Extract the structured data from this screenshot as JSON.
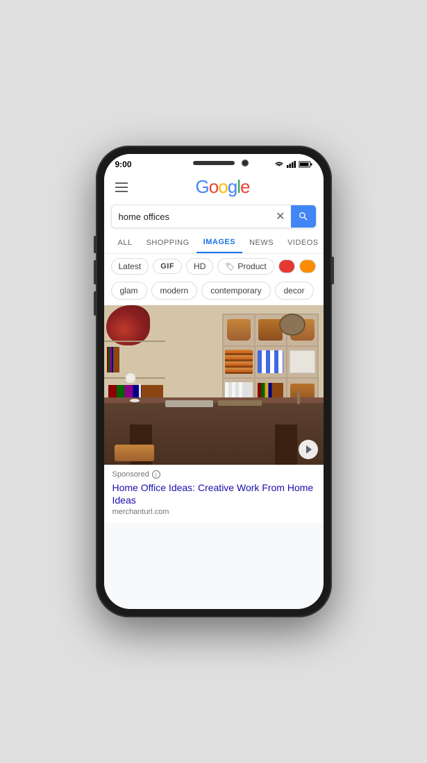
{
  "phone": {
    "status_time": "9:00"
  },
  "search": {
    "query": "home offices",
    "placeholder": "Search"
  },
  "tabs": [
    {
      "label": "ALL",
      "active": false
    },
    {
      "label": "SHOPPING",
      "active": false
    },
    {
      "label": "IMAGES",
      "active": true
    },
    {
      "label": "NEWS",
      "active": false
    },
    {
      "label": "VIDEOS",
      "active": false
    }
  ],
  "filters": [
    {
      "label": "Latest",
      "type": "text"
    },
    {
      "label": "GIF",
      "type": "gif"
    },
    {
      "label": "HD",
      "type": "text"
    },
    {
      "label": "Product",
      "type": "tag"
    },
    {
      "label": "",
      "type": "color-red",
      "color": "#e53935"
    },
    {
      "label": "",
      "type": "color-orange",
      "color": "#fb8c00"
    }
  ],
  "suggestions": [
    {
      "label": "glam"
    },
    {
      "label": "modern"
    },
    {
      "label": "contemporary"
    },
    {
      "label": "decor"
    }
  ],
  "ad": {
    "sponsored_label": "Sponsored",
    "title": "Home Office Ideas: Creative Work From Home Ideas",
    "url": "merchanturl.com"
  },
  "icons": {
    "hamburger": "☰",
    "clear": "✕",
    "search": "🔍",
    "tag": "🏷",
    "info": "i",
    "arrow": "▶"
  }
}
